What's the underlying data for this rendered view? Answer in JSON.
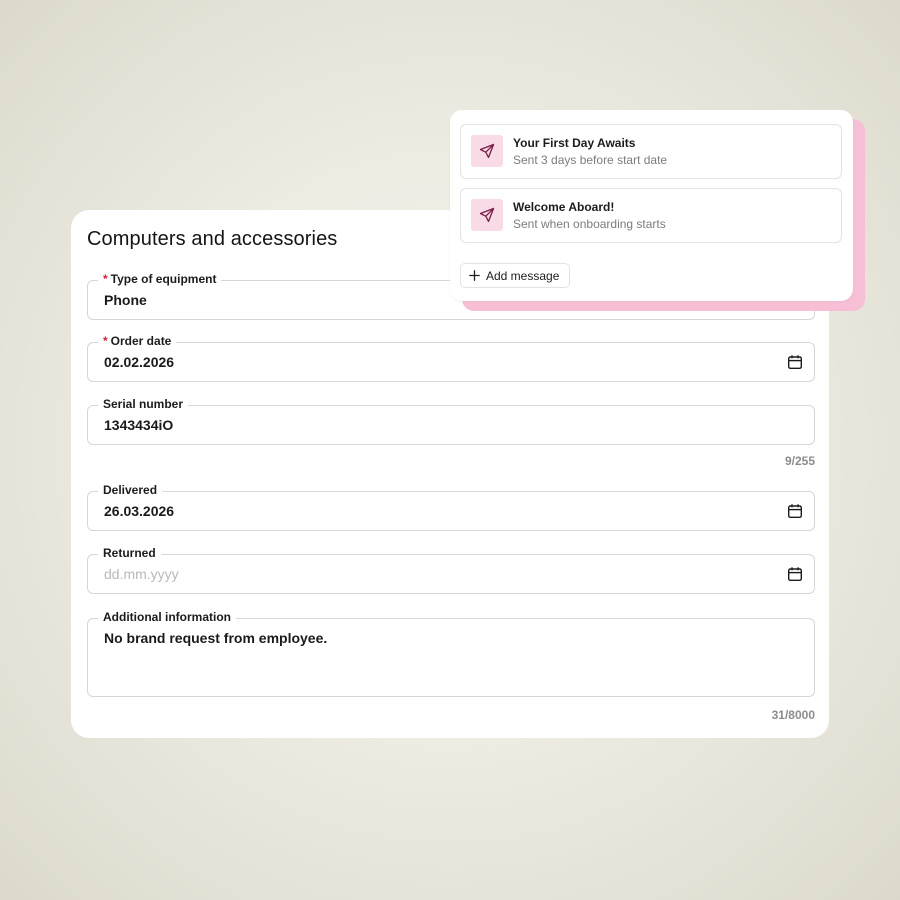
{
  "form": {
    "title": "Computers and accessories",
    "fields": {
      "type_of_equipment": {
        "label": "Type of equipment",
        "required_mark": "*",
        "value": "Phone"
      },
      "order_date": {
        "label": "Order date",
        "required_mark": "*",
        "value": "02.02.2026",
        "icon": "calendar-icon"
      },
      "serial_number": {
        "label": "Serial number",
        "value": "1343434iO",
        "counter": "9/255"
      },
      "delivered": {
        "label": "Delivered",
        "value": "26.03.2026",
        "icon": "calendar-icon"
      },
      "returned": {
        "label": "Returned",
        "placeholder": "dd.mm.yyyy",
        "icon": "calendar-icon"
      },
      "additional_information": {
        "label": "Additional information",
        "value": "No brand request from employee.",
        "counter": "31/8000"
      }
    }
  },
  "messages": {
    "items": [
      {
        "title": "Your First Day Awaits",
        "subtitle": "Sent 3 days before start date",
        "icon": "paper-plane-icon"
      },
      {
        "title": "Welcome Aboard!",
        "subtitle": "Sent when onboarding starts",
        "icon": "paper-plane-icon"
      }
    ],
    "add_label": "Add message",
    "add_icon": "plus-icon"
  },
  "colors": {
    "required_mark": "#d0213b",
    "accent_pink": "#f6bfd5",
    "icon_bg": "#f8dbe7",
    "icon_stroke": "#7a1f45"
  }
}
